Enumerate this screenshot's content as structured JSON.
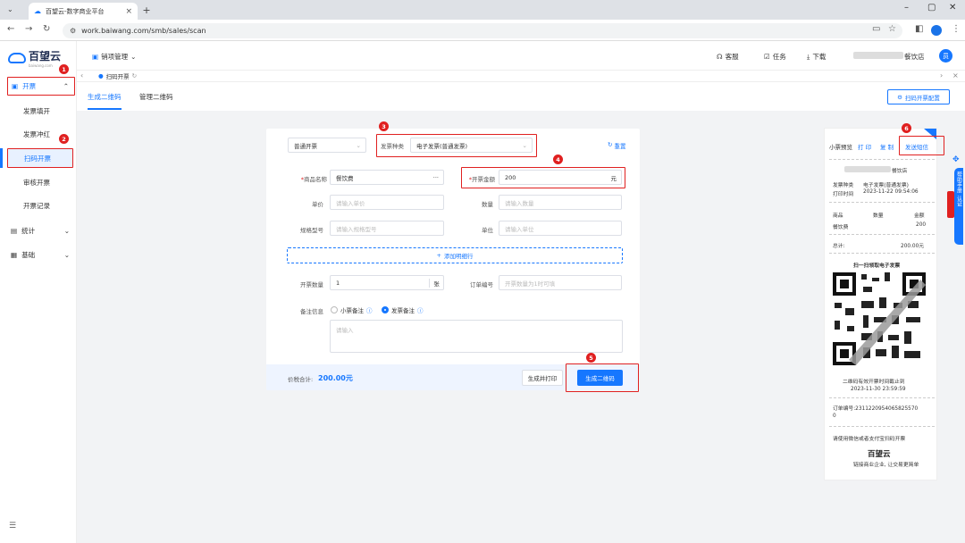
{
  "browser": {
    "tab_title": "百望云-数字商业平台",
    "url": "work.baiwang.com/smb/sales/scan"
  },
  "logo": {
    "name": "百望云",
    "sub": "baiwang.com"
  },
  "sidebar": {
    "group_invoice": "开票",
    "items": [
      "发票填开",
      "发票冲红",
      "扫码开票",
      "审核开票",
      "开票记录"
    ],
    "group_stats": "统计",
    "group_basic": "基础"
  },
  "header": {
    "project": "销项管理",
    "customer_service": "客服",
    "tasks": "任务",
    "download": "下载",
    "shop": "餐饮店",
    "avatar": "员"
  },
  "breadcrumb": {
    "tab": "扫码开票"
  },
  "tabs": {
    "generate": "生成二维码",
    "manage": "管理二维码",
    "config_button": "扫码开票配置"
  },
  "form": {
    "invoice_kind": "普通开票",
    "invoice_type_label": "发票种类",
    "invoice_type_value": "电子发票(普通发票)",
    "reset": "重置",
    "product_name_label": "商品名称",
    "product_name_value": "餐饮费",
    "amount_label": "开票金额",
    "amount_value": "200",
    "amount_unit": "元",
    "unit_price_label": "单价",
    "unit_price_placeholder": "请输入单价",
    "quantity_label": "数量",
    "quantity_placeholder": "请输入数量",
    "spec_label": "规格型号",
    "spec_placeholder": "请输入规格型号",
    "unit_label": "单位",
    "unit_placeholder": "请输入单位",
    "add_row": "添加明细行",
    "invoice_count_label": "开票数量",
    "invoice_count_value": "1",
    "invoice_count_unit": "张",
    "order_no_label": "订单编号",
    "order_no_placeholder": "开票数量为1时可填",
    "remark_label": "备注信息",
    "remark_opt_receipt": "小票备注",
    "remark_opt_invoice": "发票备注",
    "remark_placeholder": "请输入",
    "total_label": "价税合计:",
    "total_value": "200.00元",
    "btn_generate_print": "生成并打印",
    "btn_generate": "生成二维码"
  },
  "receipt": {
    "preview": "小票预览",
    "print": "打 印",
    "copy": "复 制",
    "send_sms": "发送短信",
    "shop": "餐饮店",
    "type_label": "发票种类",
    "type_value": "电子发票(普通发票)",
    "time_label": "打印时间",
    "time_value": "2023-11-22 09:54:06",
    "col_product": "商品",
    "col_qty": "数量",
    "col_amount": "金额",
    "item_name": "餐饮费",
    "item_amount": "200",
    "total_label": "总计:",
    "total_value": "200.00元",
    "scan_title": "扫一扫领取电子发票",
    "valid_label": "二维码有效开票时间截止到",
    "valid_time": "2023-11-30 23:59:59",
    "order_no": "订单编号:2311220954065825570",
    "order_no_tail": "0",
    "hint": "请使用微信或者支付宝扫码开票",
    "brand": "百望云",
    "slogan": "链接商业企业, 让交易更简单"
  },
  "right_float": {
    "label1": "帮助手册",
    "label2": "认证"
  },
  "annotations": [
    "1",
    "2",
    "3",
    "4",
    "5",
    "6"
  ]
}
